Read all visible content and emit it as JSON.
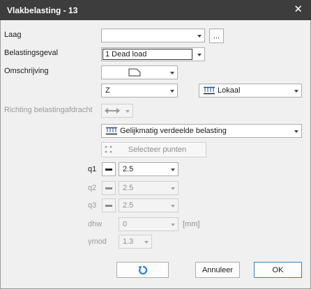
{
  "window": {
    "title": "Vlakbelasting - 13",
    "close_glyph": "✕"
  },
  "labels": {
    "laag": "Laag",
    "belastingsgeval": "Belastingsgeval",
    "omschrijving": "Omschrijving",
    "richting": "Richting belastingafdracht",
    "q1": "q1",
    "q2": "q2",
    "q3": "q3",
    "dhw": "dhw",
    "ymod": "γmod",
    "mm": "[mm]"
  },
  "fields": {
    "laag_value": "",
    "browse_label": "...",
    "belastingsgeval_value": "1 Dead load",
    "direction_value": "Z",
    "axis_value": "Lokaal",
    "distribution_value": "Gelijkmatig verdeelde belasting",
    "select_points_label": "Selecteer punten",
    "q1_value": "2.5",
    "q2_value": "2.5",
    "q3_value": "2.5",
    "dhw_value": "0",
    "ymod_value": "1.3"
  },
  "buttons": {
    "cancel": "Annuleer",
    "ok": "OK"
  },
  "colors": {
    "titlebar": "#3d3d3d",
    "accent": "#1f4e9c",
    "reset_icon": "#2f7fd0"
  },
  "icons": {
    "axis": "distributed-load-icon",
    "distribution": "distributed-load-icon",
    "select_points": "points-icon",
    "description": "rectangle-shape-icon",
    "richting": "double-arrow-icon",
    "reset": "reset-icon"
  }
}
